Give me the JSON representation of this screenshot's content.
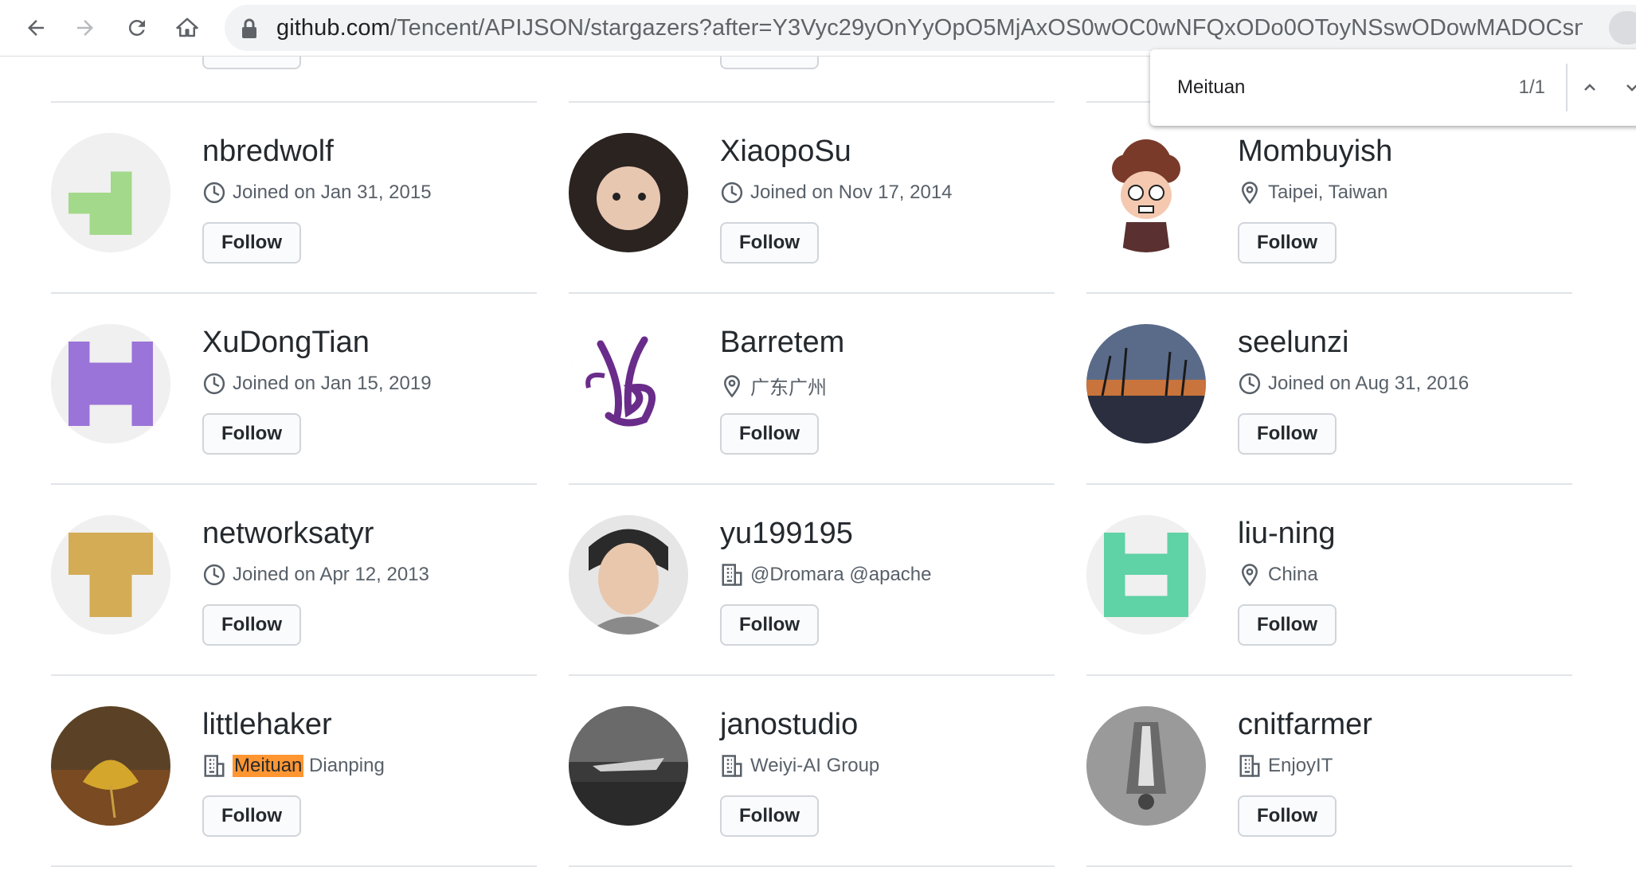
{
  "browser": {
    "url_host": "github.com",
    "url_path": "/Tencent/APIJSON/stargazers?after=Y3Vyc29yOnYyOpO5MjAxOS0wOC0wNFQxODo0OToyNSswODowMADOCsn..."
  },
  "find_bar": {
    "query": "Meituan",
    "count": "1/1"
  },
  "users": [
    {
      "name": "nbredwolf",
      "meta_icon": "clock-icon",
      "meta_text": "Joined on Jan 31, 2015",
      "follow_label": "Follow",
      "avatar": "identicon",
      "avatar_color": "#a3d98a"
    },
    {
      "name": "XiaopoSu",
      "meta_icon": "clock-icon",
      "meta_text": "Joined on Nov 17, 2014",
      "follow_label": "Follow",
      "avatar": "photo"
    },
    {
      "name": "Mombuyish",
      "meta_icon": "location-icon",
      "meta_text": "Taipei, Taiwan",
      "follow_label": "Follow",
      "avatar": "cartoon"
    },
    {
      "name": "XuDongTian",
      "meta_icon": "clock-icon",
      "meta_text": "Joined on Jan 15, 2019",
      "follow_label": "Follow",
      "avatar": "identicon",
      "avatar_color": "#9a74d8"
    },
    {
      "name": "Barretem",
      "meta_icon": "location-icon",
      "meta_text": "广东广州",
      "follow_label": "Follow",
      "avatar": "logo"
    },
    {
      "name": "seelunzi",
      "meta_icon": "clock-icon",
      "meta_text": "Joined on Aug 31, 2016",
      "follow_label": "Follow",
      "avatar": "photo"
    },
    {
      "name": "networksatyr",
      "meta_icon": "clock-icon",
      "meta_text": "Joined on Apr 12, 2013",
      "follow_label": "Follow",
      "avatar": "identicon",
      "avatar_color": "#d4ac55"
    },
    {
      "name": "yu199195",
      "meta_icon": "building-icon",
      "meta_text": "@Dromara @apache",
      "follow_label": "Follow",
      "avatar": "photo"
    },
    {
      "name": "liu-ning",
      "meta_icon": "location-icon",
      "meta_text": "China",
      "follow_label": "Follow",
      "avatar": "identicon",
      "avatar_color": "#5fd2a6"
    },
    {
      "name": "littlehaker",
      "meta_icon": "building-icon",
      "meta_highlight": "Meituan",
      "meta_text": " Dianping",
      "follow_label": "Follow",
      "avatar": "photo"
    },
    {
      "name": "janostudio",
      "meta_icon": "building-icon",
      "meta_text": "Weiyi-AI Group",
      "follow_label": "Follow",
      "avatar": "photo"
    },
    {
      "name": "cnitfarmer",
      "meta_icon": "building-icon",
      "meta_text": "EnjoyIT",
      "follow_label": "Follow",
      "avatar": "photo"
    }
  ],
  "partial_top_row": {
    "follow_label": "Follow"
  }
}
